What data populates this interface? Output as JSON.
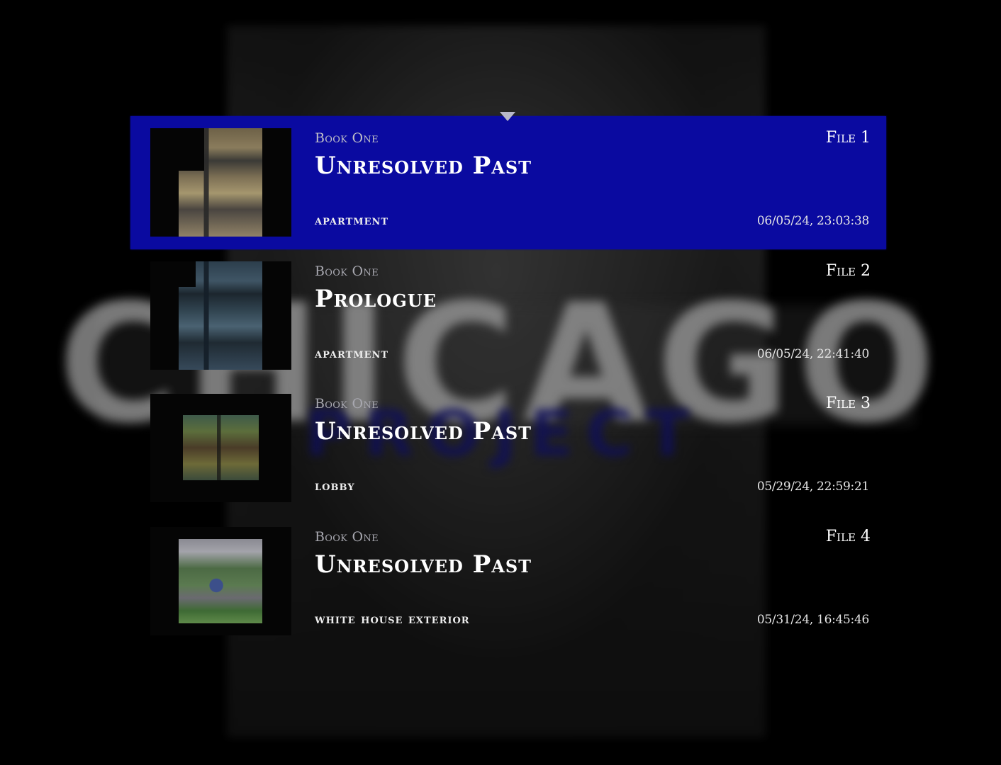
{
  "background": {
    "logo_text": "CHICAGO",
    "logo_sub_text": "PROJECT"
  },
  "colors": {
    "selected_row": "#0a0aa0",
    "background": "#000000",
    "text": "#ffffff"
  },
  "save_slots": [
    {
      "book": "Book One",
      "chapter": "Unresolved Past",
      "location": "APARTMENT",
      "file_label": "File 1",
      "timestamp": "06/05/24, 23:03:38",
      "selected": true
    },
    {
      "book": "Book One",
      "chapter": "Prologue",
      "location": "APARTMENT",
      "file_label": "File 2",
      "timestamp": "06/05/24, 22:41:40",
      "selected": false
    },
    {
      "book": "Book One",
      "chapter": "Unresolved Past",
      "location": "LOBBY",
      "file_label": "File 3",
      "timestamp": "05/29/24, 22:59:21",
      "selected": false
    },
    {
      "book": "Book One",
      "chapter": "Unresolved Past",
      "location": "WHITE HOUSE EXTERIOR",
      "file_label": "File 4",
      "timestamp": "05/31/24, 16:45:46",
      "selected": false
    }
  ]
}
